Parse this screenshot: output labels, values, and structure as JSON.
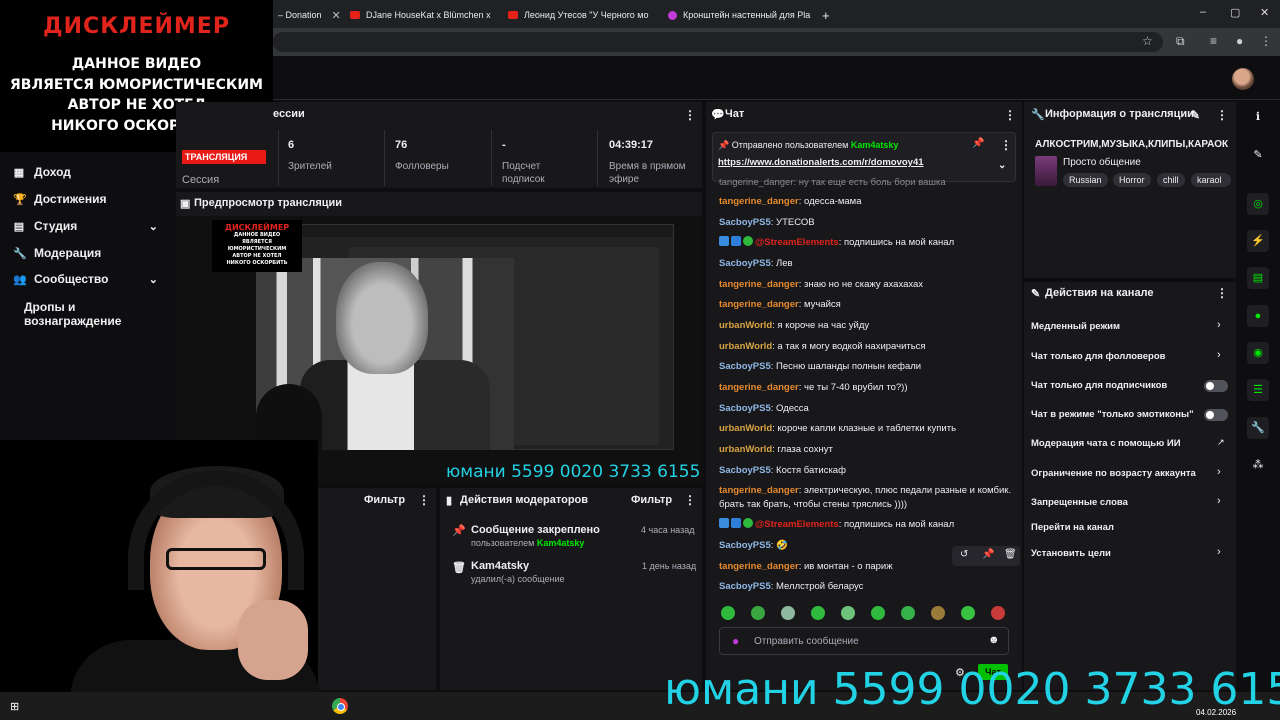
{
  "overlay": {
    "disclaimer_title": "ДИСКЛЕЙМЕР",
    "disclaimer_lines": [
      "ДАННОЕ ВИДЕО",
      "ЯВЛЯЕТСЯ ЮМОРИСТИЧЕСКИМ",
      "АВТОР НЕ ХОТЕЛ",
      "НИКОГО ОСКОРБИТЬ"
    ],
    "yoomoney_big": "юмани 5599 0020 3733 6155",
    "yoomoney_small": "юмани 5599 0020 3733 6155"
  },
  "browser": {
    "tabs": [
      {
        "label": "– Donation"
      },
      {
        "label": "DJane HouseKat x Blümchen x"
      },
      {
        "label": "Леонид Утесов \"У Черного мо"
      },
      {
        "label": "Кронштейн настенный для Pla"
      }
    ],
    "new_tab": "+",
    "controls": {
      "minimize": "–",
      "maximize": "▢",
      "close": "✕"
    }
  },
  "sidebar": {
    "items": [
      {
        "label": "Доход",
        "icon": "▦"
      },
      {
        "label": "Достижения",
        "icon": "🏆"
      },
      {
        "label": "Студия",
        "icon": "▤",
        "chevron": "⌄"
      },
      {
        "label": "Модерация",
        "icon": "🔧"
      },
      {
        "label": "Сообщество",
        "icon": "👥",
        "chevron": "⌄"
      }
    ],
    "sub_item": "Дропы и вознаграждение"
  },
  "session": {
    "title": "ессии",
    "live_badge": "ТРАНСЛЯЦИЯ",
    "session_label": "Сессия",
    "stats": [
      {
        "value": "6",
        "label": "Зрителей"
      },
      {
        "value": "76",
        "label": "Фолловеры"
      },
      {
        "value": "-",
        "label": "Подсчет подписок"
      },
      {
        "value": "04:39:17",
        "label": "Время в прямом эфире"
      }
    ]
  },
  "preview": {
    "title": "Предпросмотр трансляции"
  },
  "filter_left": {
    "label": "Фильтр"
  },
  "mod_actions": {
    "title": "Действия модераторов",
    "filter": "Фильтр",
    "items": [
      {
        "title": "Сообщение закреплено",
        "sub_prefix": "пользователем",
        "user": "Kam4atsky",
        "time": "4 часа назад"
      },
      {
        "title": "Kam4atsky",
        "sub": "удалил(-а) сообщение",
        "time": "1 день назад"
      }
    ]
  },
  "chat": {
    "title": "Чат",
    "pinned": {
      "prefix": "Отправлено пользователем",
      "user": "Kam4atsky",
      "link": "https://www.donationalerts.com/r/domovoy41"
    },
    "messages": [
      {
        "user": "tangerine_danger",
        "text": "одесса-мама",
        "color": "orange"
      },
      {
        "user": "SacboyPS5",
        "text": "УТЕСОВ",
        "color": "blue"
      },
      {
        "user": "@StreamElements",
        "text": "подпишись на мой канал",
        "color": "red",
        "badges": true
      },
      {
        "user": "SacboyPS5",
        "text": "Лев",
        "color": "blue"
      },
      {
        "user": "tangerine_danger",
        "text": "знаю но не скажу ахахахах",
        "color": "orange"
      },
      {
        "user": "tangerine_danger",
        "text": "мучайся",
        "color": "orange"
      },
      {
        "user": "urbanWorld",
        "text": "я короче на час уйду",
        "color": "gold"
      },
      {
        "user": "urbanWorld",
        "text": "а так я могу водкой нахирачиться",
        "color": "gold"
      },
      {
        "user": "SacboyPS5",
        "text": "Песню шаланды полнын кефали",
        "color": "blue"
      },
      {
        "user": "tangerine_danger",
        "text": "че ты 7-40 врубил то?))",
        "color": "orange"
      },
      {
        "user": "SacboyPS5",
        "text": "Одесса",
        "color": "blue"
      },
      {
        "user": "urbanWorld",
        "text": "короче капли клазные и таблетки купить",
        "color": "gold"
      },
      {
        "user": "urbanWorld",
        "text": "глаза сохнут",
        "color": "gold"
      },
      {
        "user": "SacboyPS5",
        "text": "Костя батискаф",
        "color": "blue"
      },
      {
        "user": "tangerine_danger",
        "text": "электрическую, плюс педали разные и комбик.",
        "color": "orange"
      },
      {
        "user": "",
        "text": "брать так брать, чтобы стены тряслись ))))",
        "color": "orange"
      },
      {
        "user": "@StreamElements",
        "text": "подпишись на мой канал",
        "color": "red",
        "badges": true
      },
      {
        "user": "SacboyPS5",
        "text": "🤣",
        "color": "blue"
      },
      {
        "user": "tangerine_danger",
        "text": "ив монтан - о париж",
        "color": "orange"
      },
      {
        "user": "SacboyPS5",
        "text": "Меллстрой беларус",
        "color": "blue"
      }
    ],
    "partial_top": "tangerine_danger: ну так еще есть боль бори вашка",
    "input_placeholder": "Отправить сообщение",
    "send_button": "Чат"
  },
  "stream_info": {
    "title": "Информация о трансляции",
    "stream_title": "АЛКОСТРИМ,МУЗЫКА,КЛИПЫ,КАРАОК",
    "category": "Просто общение",
    "tags": [
      "Russian",
      "Horror",
      "chill",
      "karaol"
    ]
  },
  "channel_actions": {
    "title": "Действия на канале",
    "items": [
      {
        "label": "Медленный режим",
        "type": "chevron"
      },
      {
        "label": "Чат только для фолловеров",
        "type": "chevron"
      },
      {
        "label": "Чат только для подписчиков",
        "type": "toggle"
      },
      {
        "label": "Чат в режиме \"только эмотиконы\"",
        "type": "toggle"
      },
      {
        "label": "Модерация чата с помощью ИИ",
        "type": "external"
      },
      {
        "label": "Ограничение по возрасту аккаунта",
        "type": "chevron"
      },
      {
        "label": "Запрещенные слова",
        "type": "chevron"
      },
      {
        "label": "Перейти на канал",
        "type": "none"
      },
      {
        "label": "Установить цели",
        "type": "chevron"
      }
    ]
  },
  "taskbar": {
    "time": "04.02.2026"
  },
  "colors": {
    "accent_green": "#00e600",
    "live_red": "#e91916",
    "yoomoney_cyan": "#22d3e6"
  }
}
